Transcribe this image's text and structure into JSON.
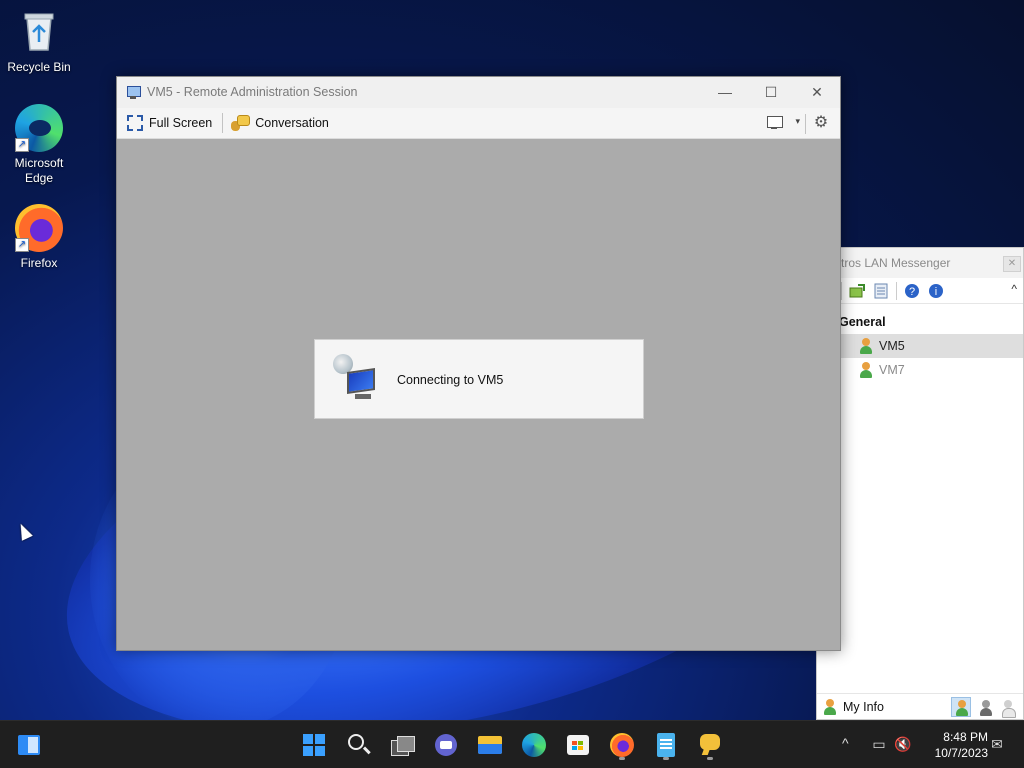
{
  "desktop": {
    "icons": [
      {
        "label": "Recycle Bin",
        "icon": "recycle-bin-icon"
      },
      {
        "label": "Microsoft Edge",
        "icon": "edge-icon"
      },
      {
        "label": "Firefox",
        "icon": "firefox-icon"
      }
    ]
  },
  "remote_window": {
    "title": "VM5 - Remote Administration Session",
    "controls": {
      "minimize": "—",
      "maximize": "☐",
      "close": "✕"
    },
    "toolbar": {
      "full_screen": "Full Screen",
      "conversation": "Conversation",
      "dropdown_caret": "▾",
      "settings_glyph": "⚙"
    },
    "connecting_text": "Connecting to VM5",
    "background_color": "#ababab"
  },
  "lan_messenger": {
    "title": "Outros LAN Messenger",
    "title_visible": "tros LAN Messenger",
    "close_glyph": "✕",
    "collapse_glyph": "^",
    "toolbar_icons": [
      "add-contact-icon",
      "history-icon",
      "help-icon",
      "info-icon"
    ],
    "toolbar_glyphs": {
      "help": "?",
      "info": "i"
    },
    "group": "General",
    "users": [
      {
        "name": "VM5",
        "selected": true,
        "online": true
      },
      {
        "name": "VM7",
        "selected": false,
        "online": false
      }
    ],
    "my_info": "My Info",
    "status_buttons": [
      "online-status-icon",
      "busy-status-icon",
      "offline-status-icon"
    ]
  },
  "taskbar": {
    "apps": [
      "widgets-icon",
      "start-icon",
      "search-icon",
      "task-view-icon",
      "teams-chat-icon",
      "file-explorer-icon",
      "edge-icon",
      "store-icon",
      "firefox-icon",
      "notepad-icon",
      "lan-messenger-icon"
    ],
    "tray": {
      "chevron": "^",
      "network_glyph": "▭",
      "volume_glyph": "🔇",
      "notification_glyph": "✉"
    },
    "time": "8:48 PM",
    "date": "10/7/2023"
  },
  "colors": {
    "taskbar_bg": "#1f1f1f",
    "selection_bg": "#dedede",
    "accent": "#3aa0ff"
  }
}
